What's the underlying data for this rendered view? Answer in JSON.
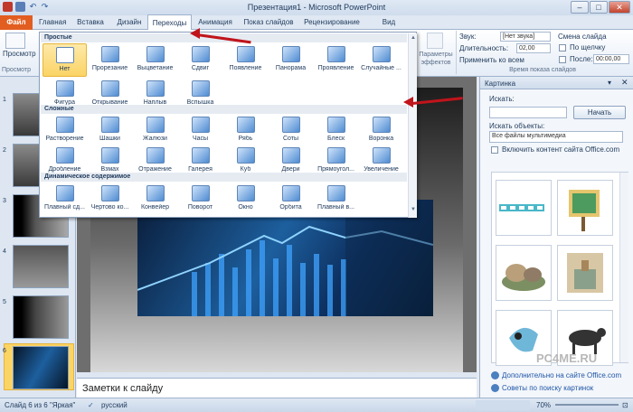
{
  "window": {
    "title": "Презентация1 - Microsoft PowerPoint",
    "min": "–",
    "max": "□",
    "close": "✕"
  },
  "tabs": [
    {
      "label": "Файл"
    },
    {
      "label": "Главная"
    },
    {
      "label": "Вставка"
    },
    {
      "label": "Дизайн"
    },
    {
      "label": "Переходы"
    },
    {
      "label": "Анимация"
    },
    {
      "label": "Показ слайдов"
    },
    {
      "label": "Рецензирование"
    },
    {
      "label": "Вид"
    }
  ],
  "ribbon": {
    "preview_label": "Просмотр",
    "preview_group": "Просмотр",
    "effects_label": "Параметры эффектов",
    "sound_label": "Звук:",
    "sound_value": "[Нет звука]",
    "duration_label": "Длительность:",
    "duration_value": "02,00",
    "apply_all": "Применить ко всем",
    "change_slide": "Смена слайда",
    "on_click": "По щелчку",
    "after": "После:",
    "after_value": "00:00,00",
    "timing_group": "Время показа слайдов"
  },
  "gallery": {
    "sections": [
      {
        "title": "Простые",
        "items": [
          "Нет",
          "Прорезание",
          "Выцветание",
          "Сдвиг",
          "Появление",
          "Панорама",
          "Проявление",
          "Случайные ...",
          "Фигура",
          "Открывание",
          "Наплыв",
          "Вспышка"
        ]
      },
      {
        "title": "Сложные",
        "items": [
          "Растворение",
          "Шашки",
          "Жалюзи",
          "Часы",
          "Рябь",
          "Соты",
          "Блеск",
          "Воронка",
          "Дробление",
          "Взмах",
          "Отражение",
          "Галерея",
          "Куб",
          "Двери",
          "Прямоугол...",
          "Увеличение"
        ]
      },
      {
        "title": "Динамическое содержимое",
        "items": [
          "Плавный сд...",
          "Чертово ко...",
          "Конвейер",
          "Поворот",
          "Окно",
          "Орбита",
          "Плавный в..."
        ]
      }
    ]
  },
  "thumbnails": [
    "1",
    "2",
    "3",
    "4",
    "5",
    "6"
  ],
  "notes_placeholder": "Заметки к слайду",
  "pane": {
    "title": "Картинка",
    "search_label": "Искать:",
    "search_value": "",
    "search_button": "Начать",
    "objects_label": "Искать объекты:",
    "objects_value": "Все файлы мультимедиа",
    "include_office": "Включить контент сайта Office.com",
    "more_link": "Дополнительно на сайте Office.com",
    "tips_link": "Советы по поиску картинок"
  },
  "status": {
    "slide": "Слайд 6 из 6",
    "theme": "\"Яркая\"",
    "lang": "русский",
    "zoom": "70%"
  },
  "watermark": "PC4ME.RU",
  "colors": {
    "file_tab": "#e25e20",
    "selected": "#fbd466",
    "arrow": "#c0141b"
  }
}
